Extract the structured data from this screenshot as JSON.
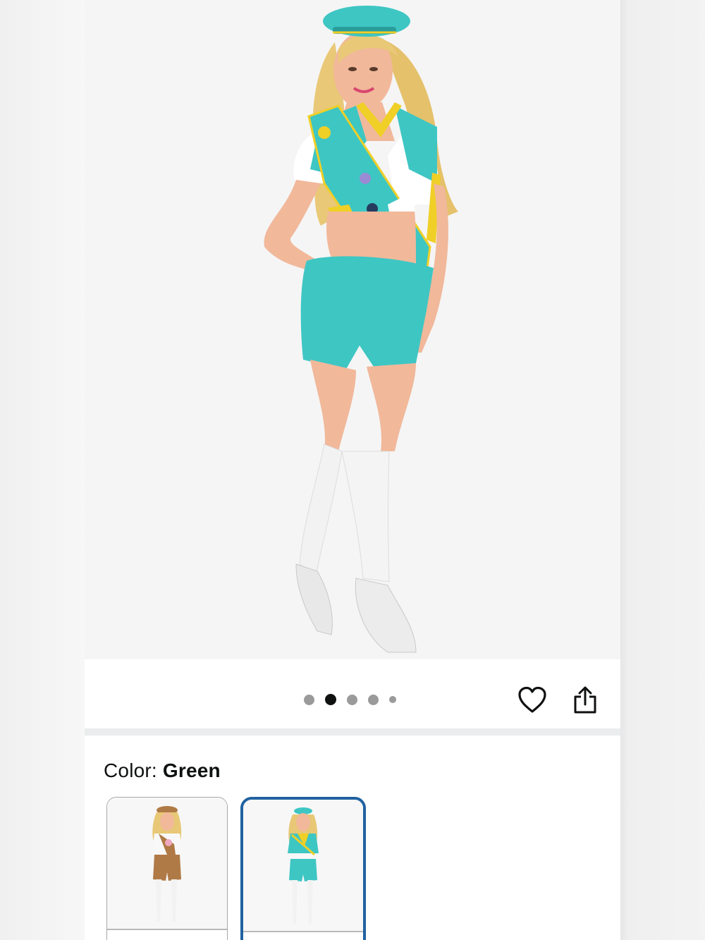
{
  "product_image": {
    "alt_icon": "product-photo"
  },
  "carousel": {
    "image_count": 5,
    "active_index": 1,
    "wishlist_icon": "heart-outline-icon",
    "share_icon": "share-icon"
  },
  "color_selector": {
    "label": "Color:",
    "selected": "Green",
    "swatches": [
      {
        "name": "brown",
        "selected": false
      },
      {
        "name": "green",
        "selected": true
      }
    ]
  },
  "colors": {
    "dot_active": "#0f1111",
    "dot_inactive": "#9a9a9a",
    "swatch_selected_border": "#2162a1",
    "costume_teal": "#3ec6c3",
    "costume_yellow": "#f0cf27"
  }
}
